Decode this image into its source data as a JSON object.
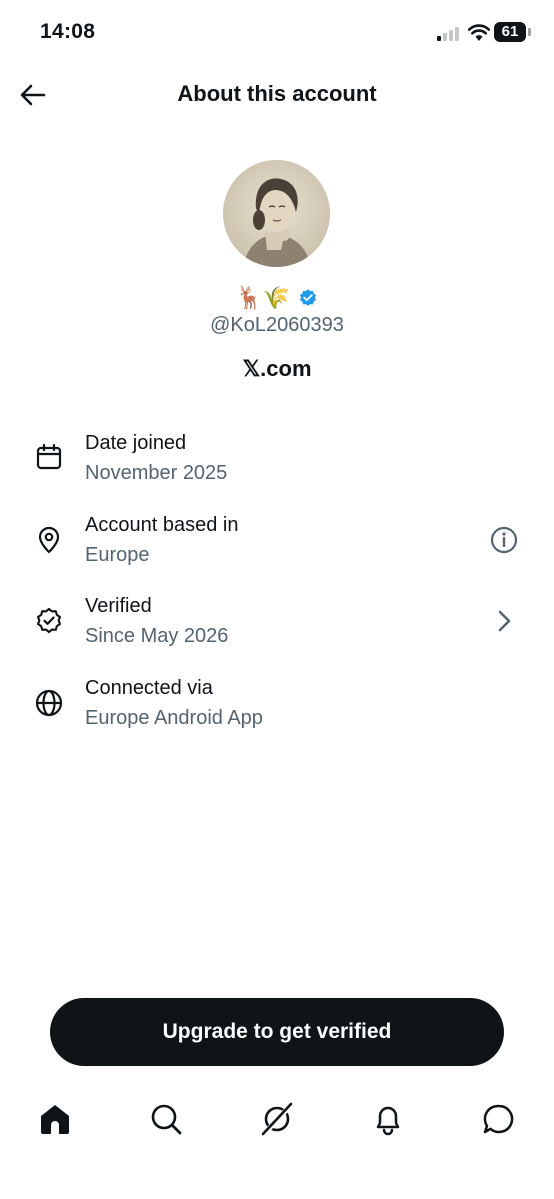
{
  "status_bar": {
    "time": "14:08",
    "battery": "61"
  },
  "header": {
    "title": "About this account"
  },
  "profile": {
    "name_emoji": "🦌🌾",
    "verified": true,
    "handle": "@KoL2060393",
    "site": "𝕏.com"
  },
  "info": [
    {
      "label": "Date joined",
      "value": "November 2025",
      "icon": "calendar-icon"
    },
    {
      "label": "Account based in",
      "value": "Europe",
      "icon": "location-pin-icon",
      "action": "info-icon"
    },
    {
      "label": "Verified",
      "value": "Since May 2026",
      "icon": "verified-check-icon",
      "action": "chevron-right-icon"
    },
    {
      "label": "Connected via",
      "value": "Europe Android App",
      "icon": "globe-icon"
    }
  ],
  "upgrade": {
    "label": "Upgrade to get verified"
  },
  "bottom_nav": [
    "home-icon",
    "search-icon",
    "grok-icon",
    "notifications-bell-icon",
    "messages-icon"
  ],
  "colors": {
    "text": "#0f1419",
    "secondary": "#536471",
    "verified_blue": "#1d9bf0",
    "button": "#0f1419"
  }
}
